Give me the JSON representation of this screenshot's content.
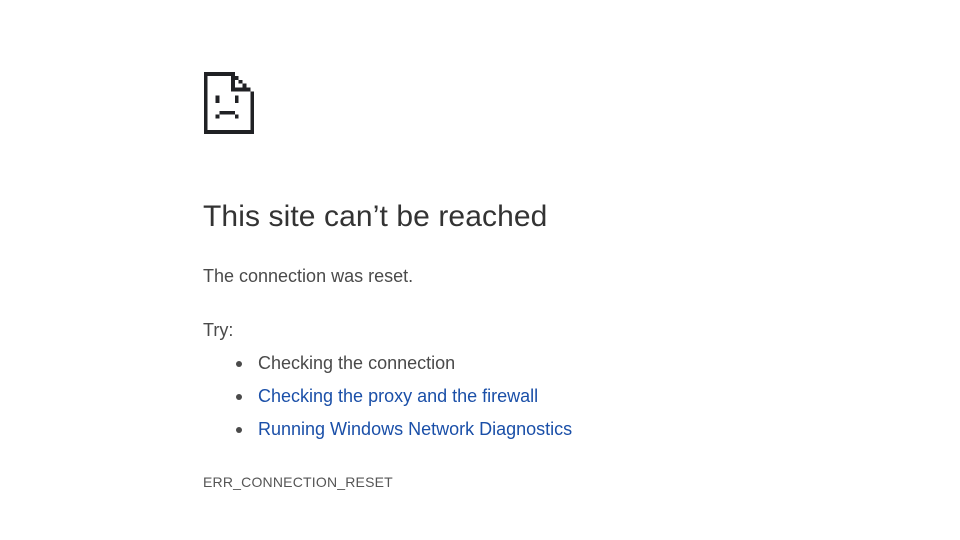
{
  "error_page": {
    "icon": "sad-page-icon",
    "title": "This site can’t be reached",
    "subtitle": "The connection was reset.",
    "try_label": "Try:",
    "suggestions": [
      {
        "label": "Checking the connection",
        "link": false
      },
      {
        "label": "Checking the proxy and the firewall",
        "link": true
      },
      {
        "label": "Running Windows Network Diagnostics",
        "link": true
      }
    ],
    "error_code": "ERR_CONNECTION_RESET",
    "colors": {
      "link": "#1a4fa8",
      "text": "#4a4a4a",
      "icon": "#202124"
    }
  }
}
